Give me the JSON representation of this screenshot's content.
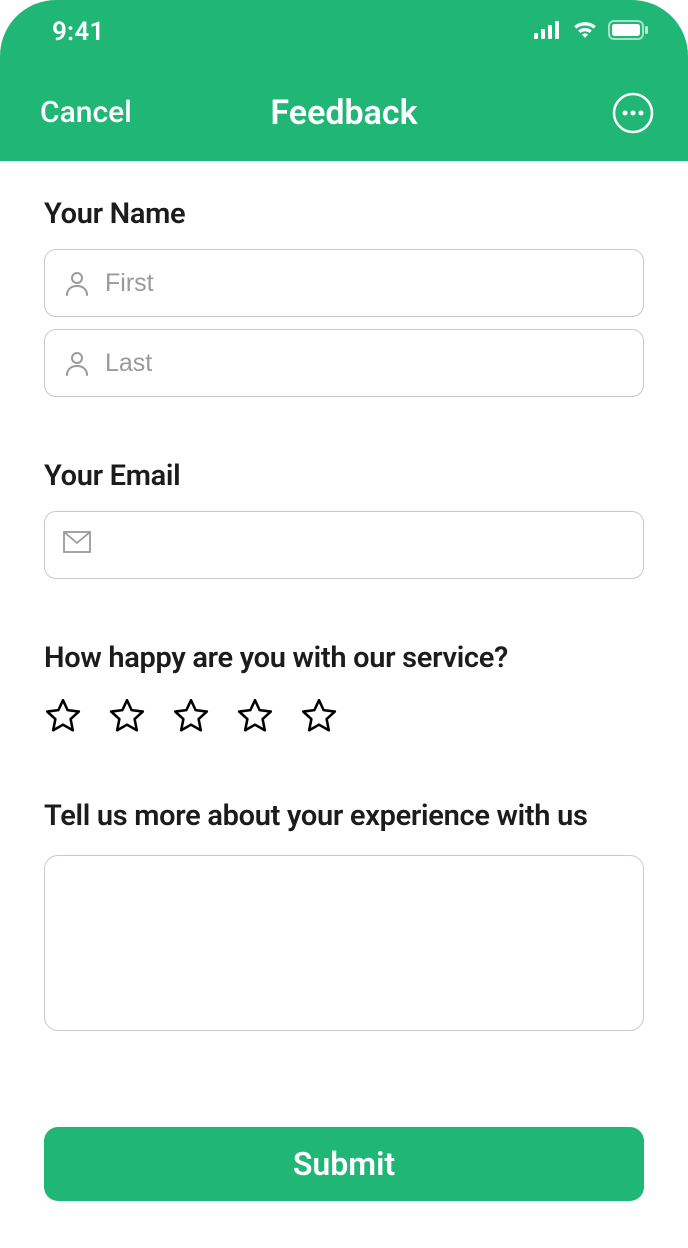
{
  "status": {
    "time": "9:41"
  },
  "nav": {
    "cancel": "Cancel",
    "title": "Feedback"
  },
  "form": {
    "name_label": "Your Name",
    "first_placeholder": "First",
    "last_placeholder": "Last",
    "email_label": "Your Email",
    "rating_label": "How happy are you with our service?",
    "experience_label": "Tell us more about your experience with us",
    "submit_label": "Submit"
  }
}
